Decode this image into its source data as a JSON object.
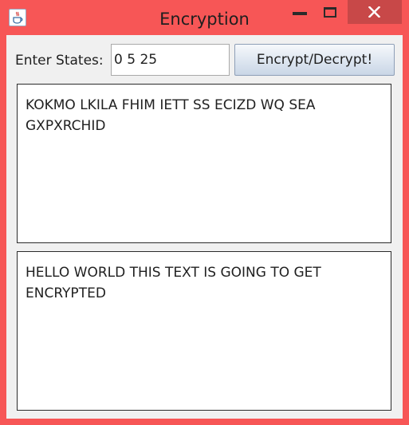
{
  "window": {
    "title": "Encryption",
    "app_icon": "java-coffee-cup-icon",
    "controls": {
      "minimize": "minimize-icon",
      "maximize": "maximize-icon",
      "close": "close-icon"
    },
    "frame_color": "#f75656",
    "close_hover_color": "#c84848"
  },
  "form": {
    "states_label": "Enter States:",
    "states_value": "0 5 25",
    "action_button_label": "Encrypt/Decrypt!"
  },
  "output": {
    "text": "KOKMO LKILA FHIM IETT SS ECIZD WQ SEA GXPXRCHID"
  },
  "input": {
    "text": "HELLO WORLD THIS TEXT IS GOING TO GET ENCRYPTED"
  }
}
